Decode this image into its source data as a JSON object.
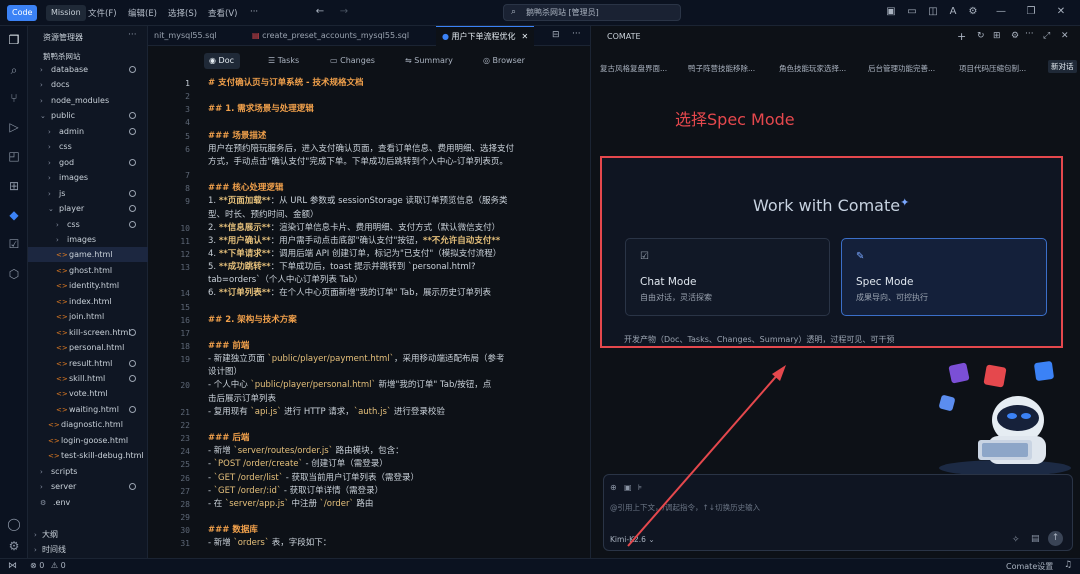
{
  "titlebar": {
    "code_label": "Code",
    "mission_label": "Mission",
    "menus": [
      "文件(F)",
      "编辑(E)",
      "选择(S)",
      "查看(V)"
    ],
    "more": "···",
    "search_text": "鹅鸭杀网站 [管理员]"
  },
  "explorer": {
    "title": "资源管理器",
    "more": "···",
    "root": "鹅鸭杀网站",
    "items": [
      {
        "label": "database",
        "dot": true
      },
      {
        "label": "docs",
        "dot": false
      },
      {
        "label": "node_modules",
        "dot": false
      },
      {
        "label": "public",
        "dot": true
      },
      {
        "label": "admin",
        "dot": true
      },
      {
        "label": "css",
        "dot": false
      },
      {
        "label": "god",
        "dot": true
      },
      {
        "label": "images",
        "dot": false
      },
      {
        "label": "js",
        "dot": true
      },
      {
        "label": "player",
        "dot": true
      },
      {
        "label": "css",
        "dot": true
      },
      {
        "label": "images",
        "dot": false
      },
      {
        "label": "game.html",
        "dot": false
      },
      {
        "label": "ghost.html",
        "dot": false
      },
      {
        "label": "identity.html",
        "dot": false
      },
      {
        "label": "index.html",
        "dot": false
      },
      {
        "label": "join.html",
        "dot": false
      },
      {
        "label": "kill-screen.html",
        "dot": true
      },
      {
        "label": "personal.html",
        "dot": false
      },
      {
        "label": "result.html",
        "dot": true
      },
      {
        "label": "skill.html",
        "dot": true
      },
      {
        "label": "vote.html",
        "dot": false
      },
      {
        "label": "waiting.html",
        "dot": true
      },
      {
        "label": "diagnostic.html",
        "dot": false
      },
      {
        "label": "login-goose.html",
        "dot": false
      },
      {
        "label": "test-skill-debug.html",
        "dot": false
      },
      {
        "label": "scripts",
        "dot": false
      },
      {
        "label": "server",
        "dot": true
      },
      {
        "label": ".env",
        "dot": false
      }
    ],
    "outline": "大纲",
    "timeline": "时间线"
  },
  "editor": {
    "tabs": [
      "nit_mysql55.sql",
      "create_preset_accounts_mysql55.sql",
      "用户下单流程优化"
    ],
    "subtabs": [
      "Doc",
      "Tasks",
      "Changes",
      "Summary",
      "Browser"
    ],
    "lines": [
      {
        "n": "1",
        "t": "# 支付确认页与订单系统 - 技术规格文档"
      },
      {
        "n": "2",
        "t": ""
      },
      {
        "n": "3",
        "t": "## 1. 需求场景与处理逻辑"
      },
      {
        "n": "4",
        "t": ""
      },
      {
        "n": "5",
        "t": "### 场景描述"
      },
      {
        "n": "6",
        "t": "用户在预约陪玩服务后，进入支付确认页面，查看订单信息、费用明细、选择支付"
      },
      {
        "n": "",
        "t": "方式，手动点击\"确认支付\"完成下单。下单成功后跳转到个人中心-订单列表页。"
      },
      {
        "n": "7",
        "t": ""
      },
      {
        "n": "8",
        "t": "### 核心处理逻辑"
      },
      {
        "n": "9",
        "t": "1. **页面加载**：从 URL 参数或 sessionStorage 读取订单预览信息（服务类"
      },
      {
        "n": "",
        "t": "型、时长、预约时间、金额）"
      },
      {
        "n": "10",
        "t": "2. **信息展示**：渲染订单信息卡片、费用明细、支付方式（默认微信支付）"
      },
      {
        "n": "11",
        "t": "3. **用户确认**：用户需手动点击底部\"确认支付\"按钮，**不允许自动支付**"
      },
      {
        "n": "12",
        "t": "4. **下单请求**：调用后端 API 创建订单，标记为\"已支付\"（模拟支付流程）"
      },
      {
        "n": "13",
        "t": "5. **成功跳转**：下单成功后，toast 提示并跳转到 `personal.html?"
      },
      {
        "n": "",
        "t": "tab=orders`（个人中心订单列表 Tab）"
      },
      {
        "n": "14",
        "t": "6. **订单列表**：在个人中心页面新增\"我的订单\" Tab，展示历史订单列表"
      },
      {
        "n": "15",
        "t": ""
      },
      {
        "n": "16",
        "t": "## 2. 架构与技术方案"
      },
      {
        "n": "17",
        "t": ""
      },
      {
        "n": "18",
        "t": "### 前端"
      },
      {
        "n": "19",
        "t": "- 新建独立页面 `public/player/payment.html`，采用移动端适配布局（参考"
      },
      {
        "n": "",
        "t": "设计图）"
      },
      {
        "n": "20",
        "t": "- 个人中心 `public/player/personal.html` 新增\"我的订单\" Tab/按钮，点"
      },
      {
        "n": "",
        "t": "击后展示订单列表"
      },
      {
        "n": "21",
        "t": "- 复用现有 `api.js` 进行 HTTP 请求，`auth.js` 进行登录校验"
      },
      {
        "n": "22",
        "t": ""
      },
      {
        "n": "23",
        "t": "### 后端"
      },
      {
        "n": "24",
        "t": "- 新增 `server/routes/order.js` 路由模块，包含："
      },
      {
        "n": "25",
        "t": "  - `POST /order/create` - 创建订单（需登录）"
      },
      {
        "n": "26",
        "t": "  - `GET /order/list` - 获取当前用户订单列表（需登录）"
      },
      {
        "n": "27",
        "t": "  - `GET /order/:id` - 获取订单详情（需登录）"
      },
      {
        "n": "28",
        "t": "- 在 `server/app.js` 中注册 `/order` 路由"
      },
      {
        "n": "29",
        "t": ""
      },
      {
        "n": "30",
        "t": "### 数据库"
      },
      {
        "n": "31",
        "t": "- 新增 `orders` 表，字段如下："
      }
    ]
  },
  "comate": {
    "title": "COMATE",
    "history": [
      "复古风格复盘界面...",
      "鸭子阵营技能移除...",
      "角色技能玩家选择...",
      "后台管理功能完善...",
      "项目代码压缩包制...",
      "新对话"
    ],
    "annotation": "选择Spec Mode",
    "work_title": "Work with Comate",
    "chat_mode": {
      "title": "Chat Mode",
      "subtitle": "自由对话，灵活探索"
    },
    "spec_mode": {
      "title": "Spec Mode",
      "subtitle": "成果导向、可控执行"
    },
    "footer_note": "开发产物（Doc、Tasks、Changes、Summary）透明，过程可见、可干预",
    "input_placeholder": "@引用上下文，/调起指令，↑↓切换历史输入",
    "model": "Kimi-K2.6"
  },
  "statusbar": {
    "errors": "0",
    "warnings": "0",
    "right_label": "Comate设置"
  },
  "colors": {
    "accent": "#3b82f6",
    "annotation_red": "#e5484d"
  }
}
